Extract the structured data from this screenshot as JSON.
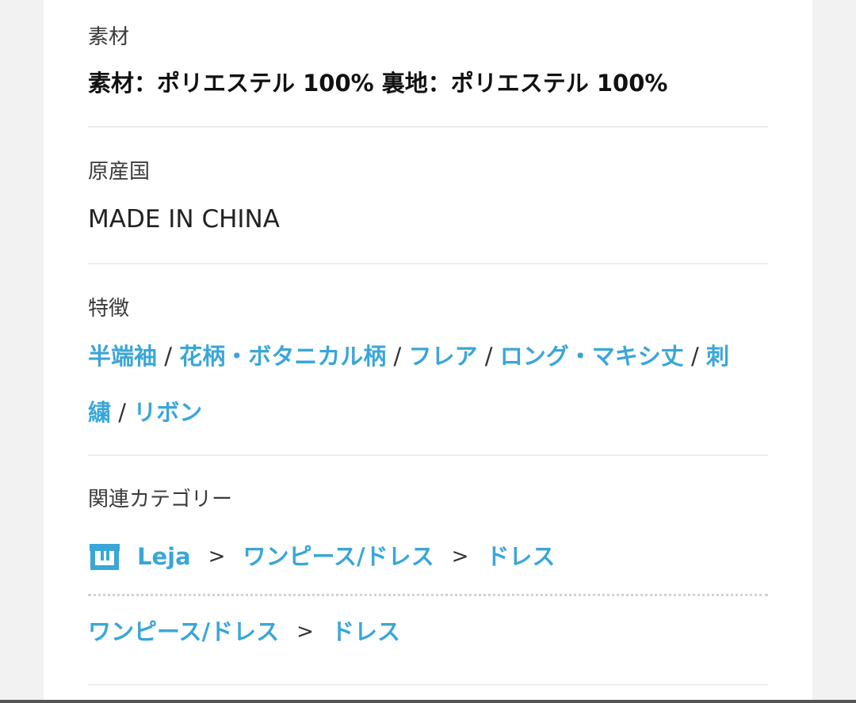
{
  "material": {
    "label": "素材",
    "value": "素材：ポリエステル 100% 裏地：ポリエステル 100%"
  },
  "origin": {
    "label": "原産国",
    "value": "MADE IN CHINA"
  },
  "features": {
    "label": "特徴",
    "line1": [
      "半端袖",
      "花柄・ボタニカル柄",
      "フレア",
      "ロング・マキシ丈",
      "刺"
    ],
    "line2": [
      "繍",
      "リボン"
    ],
    "separator": "/"
  },
  "categories": {
    "label": "関連カテゴリー",
    "separator": ">",
    "path1": [
      "Leja",
      "ワンピース/ドレス",
      "ドレス"
    ],
    "path2": [
      "ワンピース/ドレス",
      "ドレス"
    ],
    "shop_icon": "shop-icon"
  },
  "colors": {
    "link": "#3aa6d8",
    "background": "#f2f2f2"
  }
}
